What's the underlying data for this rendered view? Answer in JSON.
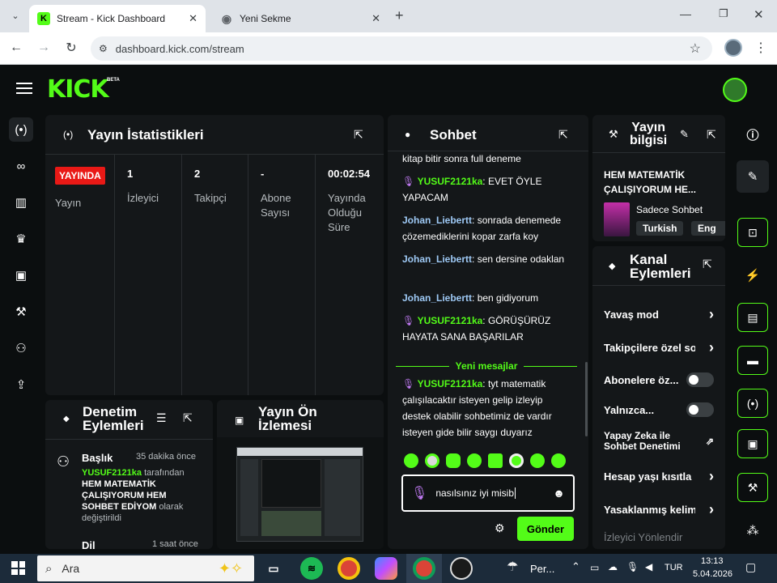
{
  "browser": {
    "tabs": [
      {
        "title": "Stream - Kick Dashboard",
        "active": true
      },
      {
        "title": "Yeni Sekme",
        "active": false
      }
    ],
    "url": "dashboard.kick.com/stream"
  },
  "header": {
    "logo": "KICK",
    "beta": "BETA"
  },
  "stats": {
    "title": "Yayın İstatistikleri",
    "live_badge": "YAYINDA",
    "live_label": "Yayın",
    "columns": [
      {
        "value": "1",
        "label": "İzleyici"
      },
      {
        "value": "2",
        "label": "Takipçi"
      },
      {
        "value": "-",
        "label": "Abone Sayısı"
      },
      {
        "value": "00:02:54",
        "label": "Yayında Olduğu Süre"
      }
    ]
  },
  "chat": {
    "title": "Sohbet",
    "top_fragment": "kitap bitir sonra full deneme",
    "messages": [
      {
        "user": "YUSUF2121ka",
        "text": "EVET ÖYLE YAPACAM",
        "mic": true
      },
      {
        "user": "Johan_Liebertt",
        "text": "sonrada denemede çözemediklerini kopar zarfa koy",
        "mic": false
      },
      {
        "user": "Johan_Liebertt",
        "text": "sen dersine odaklan",
        "mic": false
      },
      {
        "user": "Johan_Liebertt",
        "text": "ben gidiyorum",
        "mic": false
      },
      {
        "user": "YUSUF2121ka",
        "text": "GÖRÜŞÜRÜZ HAYATA SANA BAŞARILAR",
        "mic": true
      }
    ],
    "new_messages_label": "Yeni mesajlar",
    "new_message": {
      "user": "YUSUF2121ka",
      "text": "tyt matematik çalışılacaktır isteyen gelip izleyip destek olabilir sohbetimiz de vardır isteyen gide bilir saygı duyarız"
    },
    "input_value": "nasılsınız iyi misib",
    "send_label": "Gönder"
  },
  "stream_info": {
    "title_line1": "Yayın",
    "title_line2": "bilgisi",
    "stream_title": "HEM MATEMATİK ÇALIŞIYORUM HE...",
    "category": "Sadece Sohbet",
    "tags": [
      "Turkish",
      "Eng"
    ]
  },
  "channel_actions": {
    "title_line1": "Kanal",
    "title_line2": "Eylemleri",
    "items": [
      {
        "label": "Yavaş mod",
        "control": "chevron"
      },
      {
        "label": "Takipçilere özel so",
        "control": "chevron"
      },
      {
        "label": "Abonelere öz...",
        "control": "toggle"
      },
      {
        "label": "Yalnızca...",
        "control": "toggle"
      },
      {
        "label": "Yapay Zeka ile Sohbet Denetimi",
        "control": "external"
      },
      {
        "label": "Hesap yaşı kısıtla",
        "control": "chevron"
      },
      {
        "label": "Yasaklanmış kelim",
        "control": "chevron"
      },
      {
        "label": "İzleyici Yönlendir",
        "control": "none"
      }
    ]
  },
  "moderation": {
    "title_line1": "Denetim",
    "title_line2": "Eylemleri",
    "entry_title": "Başlık",
    "entry_time": "35 dakika önce",
    "entry_user": "YUSUF2121ka",
    "entry_text_1": "tarafından",
    "entry_bold": "HEM MATEMATİK ÇALIŞIYORUM HEM SOHBET EDİYOM",
    "entry_text_2": "olarak değiştirildi",
    "next_title": "Dil",
    "next_time": "1 saat önce"
  },
  "preview": {
    "title_line1": "Yayın Ön",
    "title_line2": "İzlemesi"
  },
  "taskbar": {
    "search": "Ara",
    "weather": "Per...",
    "lang": "TUR",
    "time": "13:13",
    "date": "5.04.2026"
  },
  "colors": {
    "accent": "#53fc18",
    "live": "#e91916",
    "panel": "#141719",
    "bg": "#0b0e0f"
  }
}
